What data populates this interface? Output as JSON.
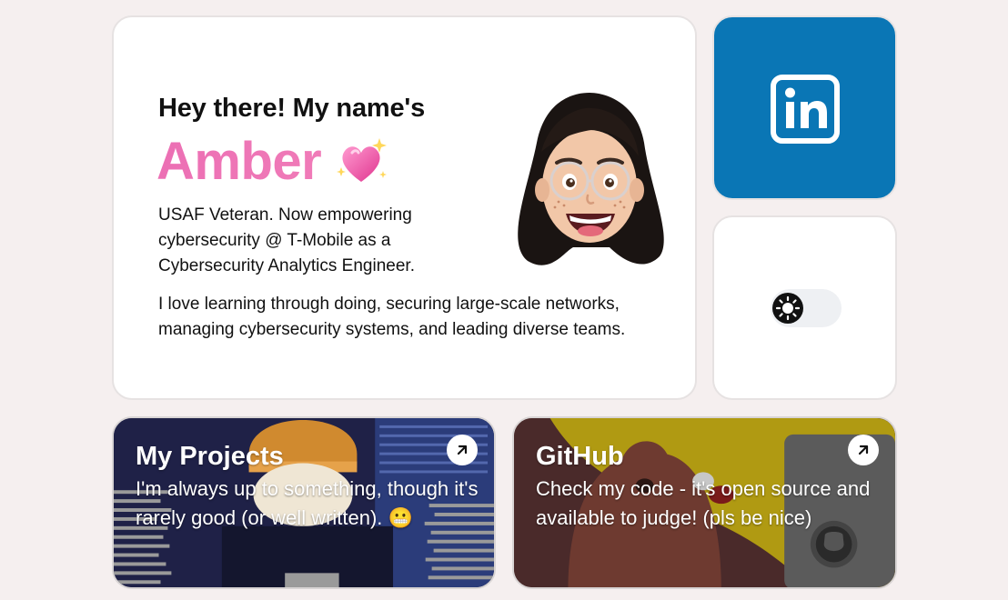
{
  "intro": {
    "greeting": "Hey there! My name's",
    "name": "Amber",
    "name_emoji": "sparkling-heart-icon",
    "bio": "USAF Veteran. Now empowering cybersecurity @ T-Mobile as a Cybersecurity Analytics Engineer.",
    "love": "I love learning through doing, securing large-scale networks, managing cybersecurity systems, and leading diverse teams.",
    "avatar": "memoji-avatar"
  },
  "linkedin": {
    "icon": "linkedin-icon",
    "color": "#0a76b5"
  },
  "theme_toggle": {
    "icon": "sun-icon",
    "state": "light"
  },
  "tiles": [
    {
      "title": "My Projects",
      "description": "I'm always up to something, though it's rarely good (or well written). 😬",
      "icon": "arrow-up-right-icon"
    },
    {
      "title": "GitHub",
      "description": "Check my code - it's open source and available to judge! (pls be nice)",
      "icon": "arrow-up-right-icon"
    }
  ],
  "colors": {
    "accent_pink": "#ec6fb4",
    "background": "#f5efef",
    "linkedin_blue": "#0a76b5"
  }
}
